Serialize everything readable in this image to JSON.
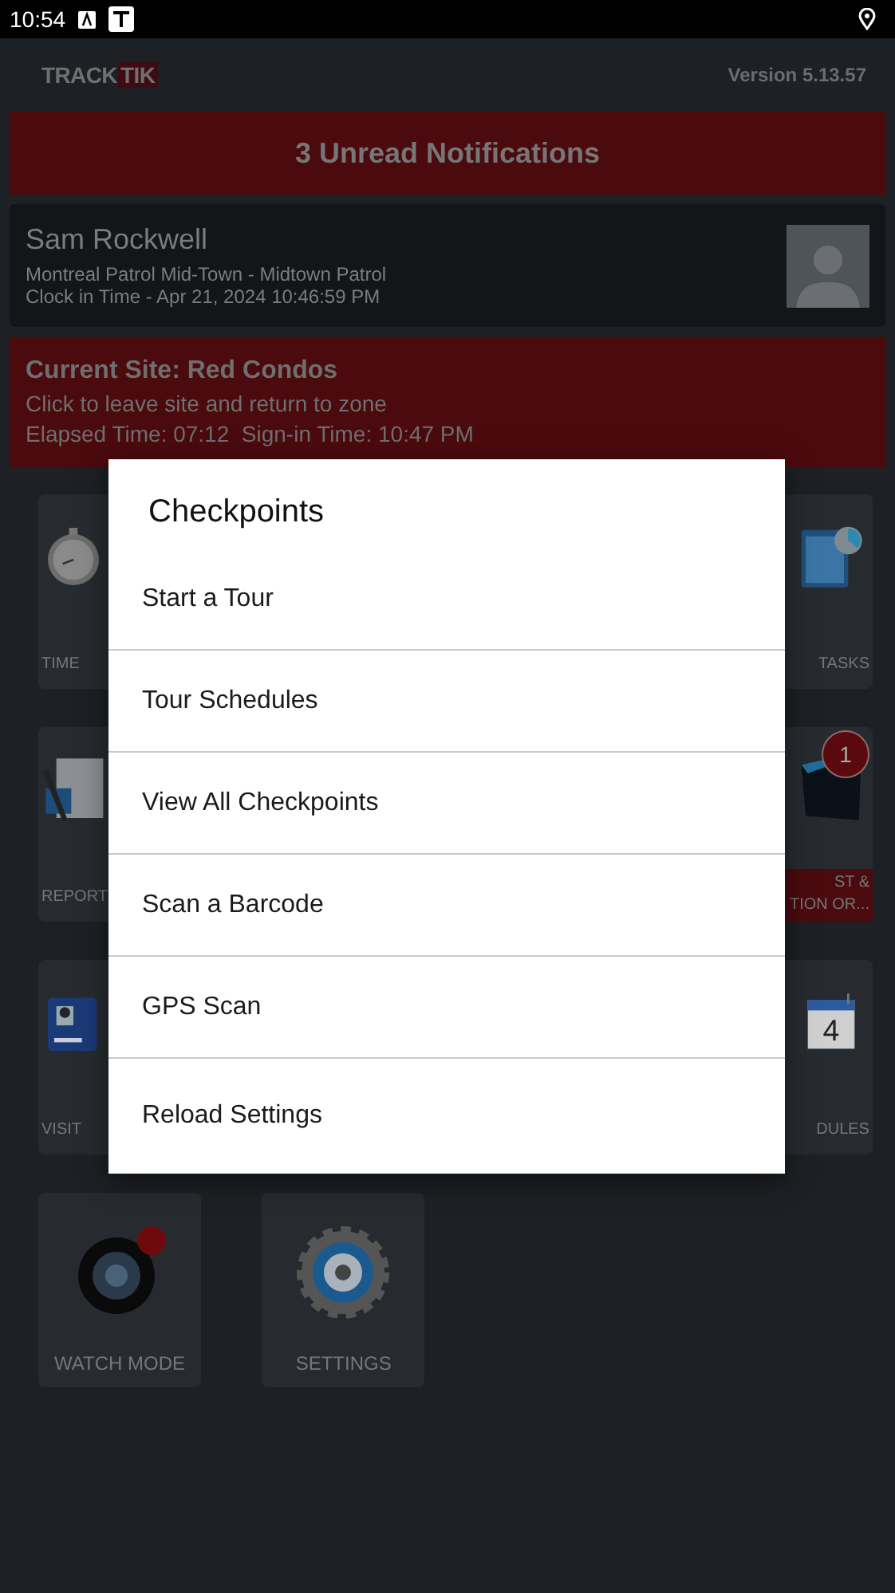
{
  "status_bar": {
    "time": "10:54"
  },
  "header": {
    "logo": [
      "TRACK",
      "TIK"
    ],
    "version": "Version 5.13.57"
  },
  "notifications": {
    "text": "3 Unread Notifications"
  },
  "user": {
    "name": "Sam Rockwell",
    "zone": "Montreal Patrol Mid-Town - Midtown Patrol",
    "clock_in": "Clock in Time - Apr 21, 2024 10:46:59 PM"
  },
  "site": {
    "title": "Current Site: Red Condos",
    "hint": "Click to leave site and return to zone",
    "times": "Elapsed Time: 07:12  Sign-in Time: 10:47 PM"
  },
  "tile_rows": [
    {
      "kind": "covered",
      "left": [
        {
          "kind": "stopwatch",
          "label": [
            "TIME"
          ]
        }
      ],
      "right": [
        {
          "kind": "clipboard",
          "label": [
            "TASKS"
          ]
        }
      ]
    },
    {
      "kind": "covered",
      "left": [
        {
          "kind": "notepad",
          "label": [
            "REPORT"
          ]
        }
      ],
      "right": [
        {
          "kind": "folder",
          "label": [
            "ST &",
            "TION OR..."
          ],
          "alert": true,
          "badge": "1"
        }
      ]
    },
    {
      "kind": "covered",
      "left": [
        {
          "kind": "id-card",
          "label": [
            "VISIT"
          ]
        }
      ],
      "right": [
        {
          "kind": "calendar",
          "label": [
            "DULES"
          ],
          "calendar_day": "4"
        }
      ]
    },
    {
      "kind": "full",
      "left": [
        {
          "kind": "camera",
          "label": [
            "WATCH MODE"
          ]
        },
        {
          "kind": "gear",
          "label": [
            "SETTINGS"
          ]
        }
      ]
    }
  ],
  "dialog": {
    "title": "Checkpoints",
    "items": [
      "Start a Tour",
      "Tour Schedules",
      "View All Checkpoints",
      "Scan a Barcode",
      "GPS Scan",
      "Reload Settings"
    ]
  }
}
